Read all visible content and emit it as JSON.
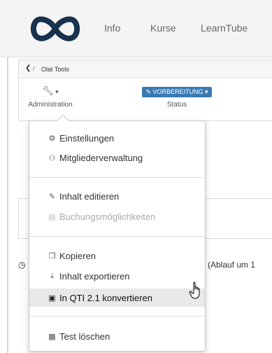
{
  "topnav": {
    "items": [
      "Info",
      "Kurse",
      "LearnTube"
    ]
  },
  "breadcrumb": {
    "back": "❮",
    "separator": "/",
    "current": "Olat Tools"
  },
  "toolbar": {
    "administration_label": "Administration",
    "status_label": "Status",
    "status_value": "✎ VORBEREITUNG ▾"
  },
  "dropdown": {
    "items": [
      {
        "label": "Einstellungen",
        "icon": "gears-icon"
      },
      {
        "label": "Mitgliederverwaltung",
        "icon": "users-icon"
      },
      {
        "label": "Inhalt editieren",
        "icon": "edit-icon"
      },
      {
        "label": "Buchungsmöglichkeiten",
        "icon": "cart-icon",
        "disabled": true
      },
      {
        "label": "Kopieren",
        "icon": "copy-icon"
      },
      {
        "label": "Inhalt exportieren",
        "icon": "download-icon"
      },
      {
        "label": "In QTI 2.1 konvertieren",
        "icon": "convert-icon",
        "active": true
      },
      {
        "label": "Test löschen",
        "icon": "trash-icon"
      }
    ]
  },
  "background": {
    "partial_text": "(Ablauf um 1"
  },
  "colors": {
    "logo": "#17324d",
    "status_badge": "#3a7ab3",
    "active_item": "#e8e8e8"
  }
}
